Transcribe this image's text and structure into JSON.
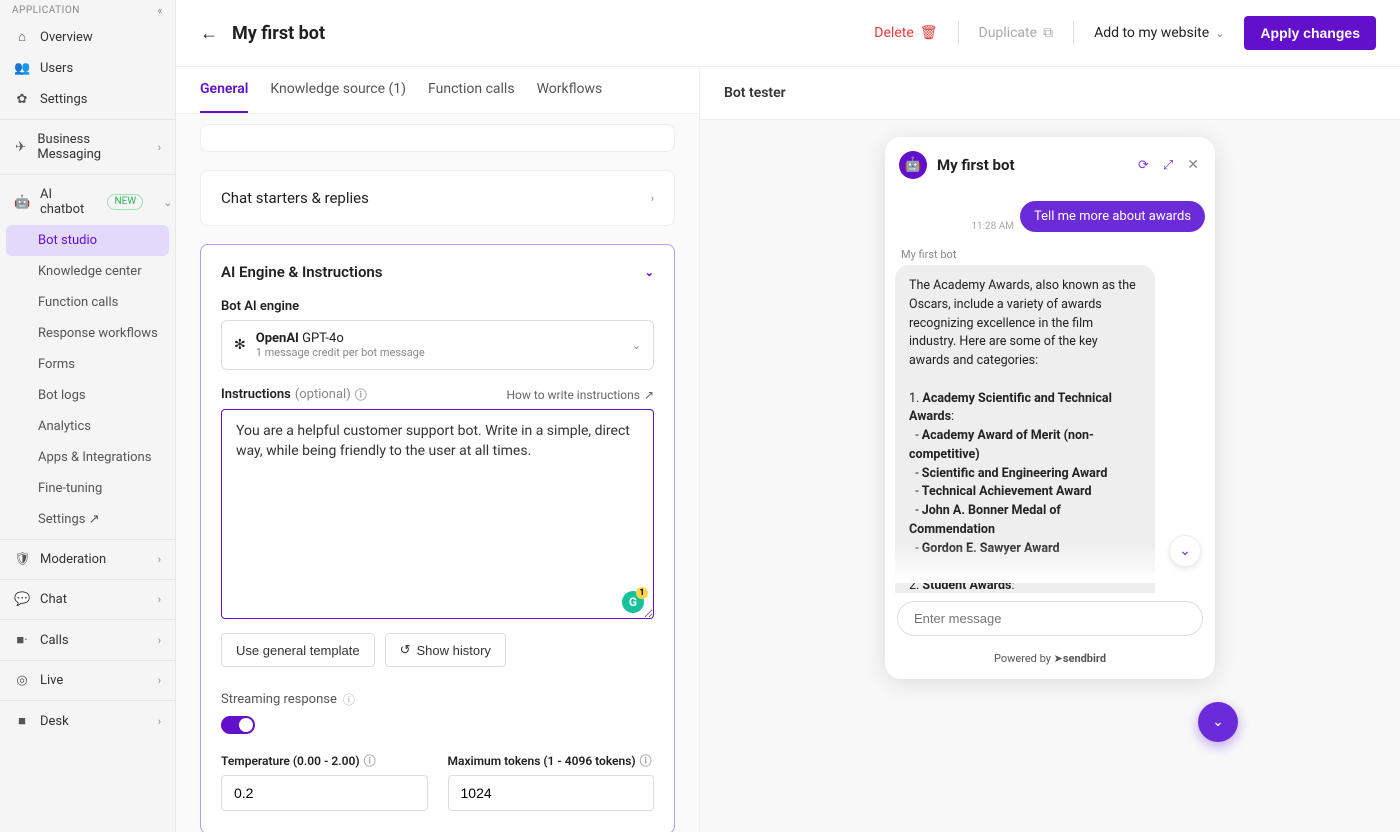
{
  "sidebar": {
    "header": "APPLICATION",
    "overview": "Overview",
    "users": "Users",
    "settings": "Settings",
    "business": "Business Messaging",
    "ai_chatbot": "AI chatbot",
    "badge_new": "NEW",
    "bot_studio": "Bot studio",
    "knowledge_center": "Knowledge center",
    "function_calls": "Function calls",
    "response_workflows": "Response workflows",
    "forms": "Forms",
    "bot_logs": "Bot logs",
    "analytics": "Analytics",
    "apps_integrations": "Apps & Integrations",
    "fine_tuning": "Fine-tuning",
    "settings2": "Settings ↗",
    "moderation": "Moderation",
    "chat": "Chat",
    "calls": "Calls",
    "live": "Live",
    "desk": "Desk"
  },
  "top": {
    "title": "My first bot",
    "delete": "Delete",
    "duplicate": "Duplicate",
    "add_website": "Add to my website",
    "apply": "Apply changes"
  },
  "tabs": {
    "general": "General",
    "knowledge": "Knowledge source (1)",
    "function": "Function calls",
    "workflows": "Workflows"
  },
  "cards": {
    "starters": "Chat starters & replies",
    "ai_engine_title": "AI Engine & Instructions",
    "engine_label": "Bot AI engine",
    "engine_brand": "OpenAI",
    "engine_model": "GPT-4o",
    "engine_sub": "1 message credit per bot message",
    "instructions_label": "Instructions",
    "instructions_optional": "(optional)",
    "how_to_write": "How to write instructions",
    "instructions_value": "You are a helpful customer support bot. Write in a simple, direct way, while being friendly to the user at all times.",
    "use_template": "Use general template",
    "show_history": "Show history",
    "streaming": "Streaming response",
    "temp_label": "Temperature (0.00 - 2.00)",
    "temp_value": "0.2",
    "max_tokens_label": "Maximum tokens (1 - 4096 tokens)",
    "max_tokens_value": "1024"
  },
  "tester": {
    "header": "Bot tester",
    "bot_name": "My first bot",
    "timestamp": "11:28 AM",
    "user_msg": "Tell me more about awards",
    "bot_label": "My first bot",
    "input_placeholder": "Enter message",
    "powered_prefix": "Powered by ",
    "powered_brand": "sendbird"
  }
}
